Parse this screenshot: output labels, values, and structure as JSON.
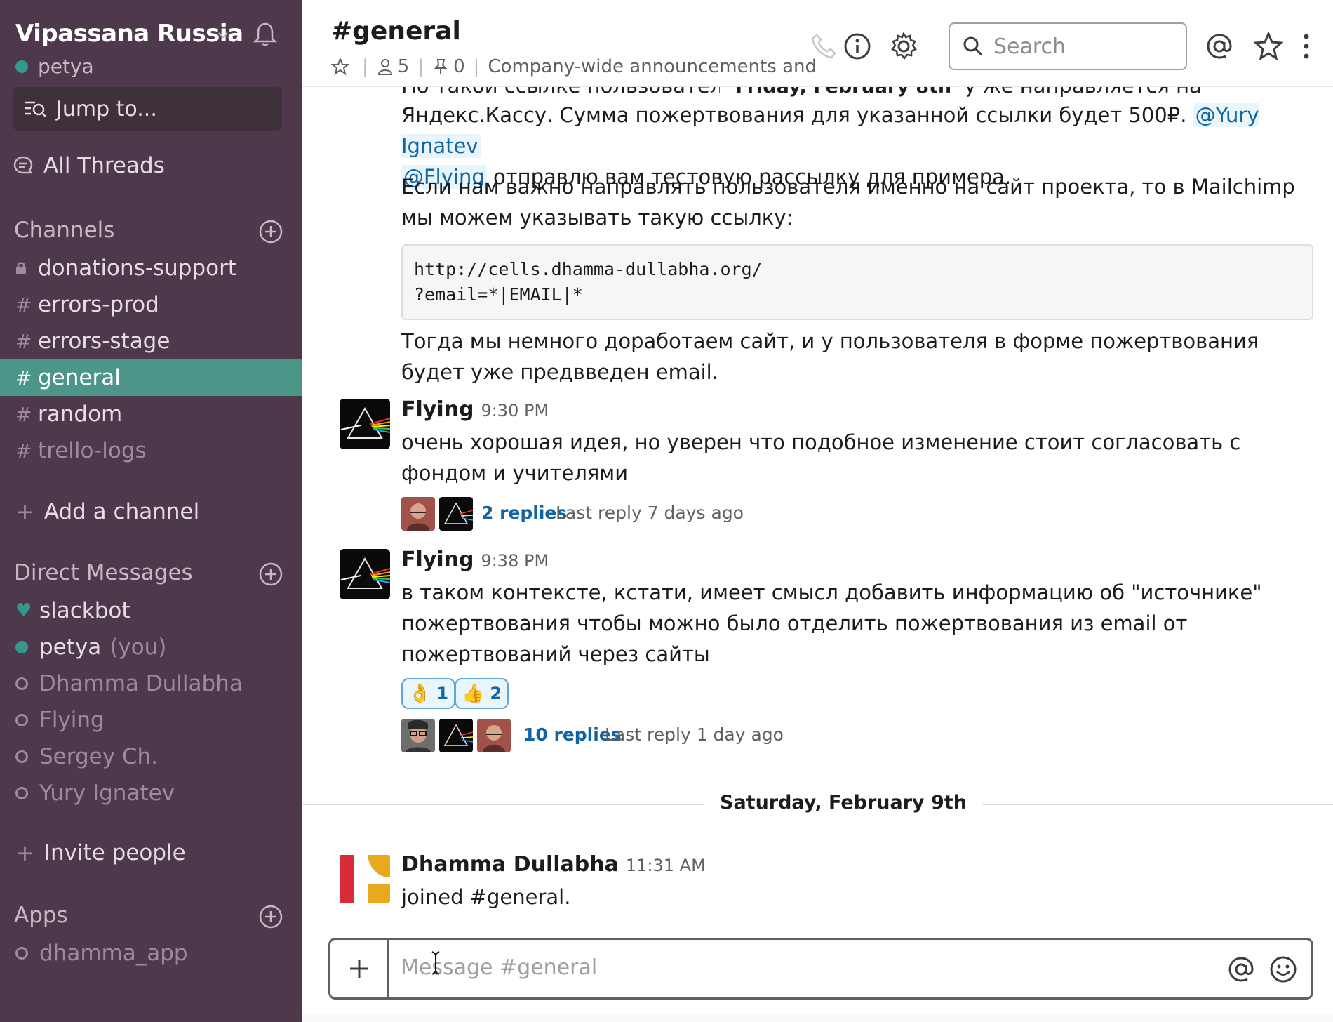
{
  "workspace": {
    "name": "Vipassana Russia",
    "user": "petya"
  },
  "sidebar": {
    "jump_label": "Jump to...",
    "threads_label": "All Threads",
    "channels_title": "Channels",
    "channels": [
      {
        "prefix": "lock",
        "name": "donations-support"
      },
      {
        "prefix": "#",
        "name": "errors-prod"
      },
      {
        "prefix": "#",
        "name": "errors-stage"
      },
      {
        "prefix": "#",
        "name": "general",
        "active": true
      },
      {
        "prefix": "#",
        "name": "random"
      },
      {
        "prefix": "#",
        "name": "trello-logs",
        "muted": true
      }
    ],
    "add_channel": "Add a channel",
    "dm_title": "Direct Messages",
    "dms": [
      {
        "name": "slackbot",
        "status": "heart"
      },
      {
        "name": "petya",
        "status": "online",
        "suffix": "(you)"
      },
      {
        "name": "Dhamma Dullabha",
        "status": "offline"
      },
      {
        "name": "Flying",
        "status": "offline"
      },
      {
        "name": "Sergey Ch.",
        "status": "offline"
      },
      {
        "name": "Yury Ignatev",
        "status": "offline"
      }
    ],
    "invite": "Invite people",
    "apps_title": "Apps",
    "apps": [
      {
        "name": "dhamma_app",
        "status": "offline"
      }
    ]
  },
  "header": {
    "channel": "#general",
    "members": "5",
    "pins": "0",
    "topic": "Company-wide announcements and work-based matters",
    "search_placeholder": "Search"
  },
  "messages": {
    "date1": "Friday, February 8th",
    "partial_line": "По такой ссылке пользователь п... дисне Чер и сразу же направляется на",
    "p1_text": "Яндекс.Кассу. Сумма пожертвования для указанной ссылки будет 500₽.",
    "p1_mention1": "@Yury Ignatev",
    "p1_mention2": "@Flying",
    "p1_rest": "отправлю вам тестовую рассылку для примера.",
    "p2": "Если нам важно направлять пользователя именно на сайт проекта, то в Mailchimp мы можем указывать такую ссылку:",
    "code": "http://cells.dhamma-dullabha.org/\n?email=*|EMAIL|*",
    "p3": "Тогда мы немного доработаем сайт, и у пользователя в форме пожертвования будет уже предвведен email.",
    "m1": {
      "author": "Flying",
      "time": "9:30 PM",
      "text": "очень хорошая идея, но уверен что подобное изменение стоит согласовать с фондом и учителями",
      "replies": "2 replies",
      "last_reply": "Last reply 7 days ago"
    },
    "m2": {
      "author": "Flying",
      "time": "9:38 PM",
      "text": "в таком контексте, кстати, имеет смысл добавить информацию об \"источнике\" пожертвования чтобы можно было отделить пожертвования из email от пожертвований через сайты",
      "reactions": [
        {
          "emoji": "👌",
          "count": "1"
        },
        {
          "emoji": "👍",
          "count": "2"
        }
      ],
      "replies": "10 replies",
      "last_reply": "Last reply 1 day ago"
    },
    "date2": "Saturday, February 9th",
    "m3": {
      "author": "Dhamma Dullabha",
      "time": "11:31 AM",
      "text": "joined #general."
    }
  },
  "composer": {
    "placeholder": "Message #general"
  },
  "colors": {
    "sidebar": "#4d394b",
    "active_channel": "#4c9689",
    "link": "#1264a3",
    "online": "#38978d"
  }
}
